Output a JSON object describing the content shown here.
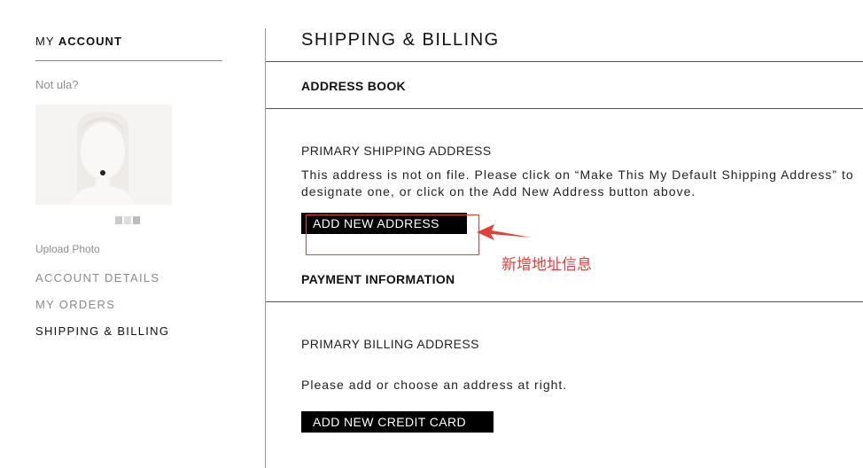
{
  "sidebar": {
    "heading_prefix": "MY",
    "heading_strong": "ACCOUNT",
    "not_user": "Not ula?",
    "upload_photo": "Upload Photo",
    "items": [
      {
        "label": "ACCOUNT DETAILS",
        "active": false
      },
      {
        "label": "MY ORDERS",
        "active": false
      },
      {
        "label": "SHIPPING & BILLING",
        "active": true
      }
    ]
  },
  "main": {
    "title": "SHIPPING & BILLING",
    "address_book": {
      "title": "ADDRESS BOOK",
      "primary_shipping_label": "PRIMARY SHIPPING ADDRESS",
      "notice": "This address is not on file. Please click on “Make This My Default Shipping Address” to designate one, or click on the Add New Address button above.",
      "add_address_button": "ADD NEW ADDRESS"
    },
    "payment": {
      "title": "PAYMENT INFORMATION",
      "primary_billing_label": "PRIMARY BILLING ADDRESS",
      "notice": "Please add or choose an address at right.",
      "add_card_button": "ADD NEW CREDIT CARD"
    }
  },
  "annotation": {
    "text": "新增地址信息",
    "color": "#e0403a"
  },
  "colors": {
    "accent": "#000000",
    "muted_text": "#8d8d8d",
    "avatar_bg": "#f6f4f3"
  }
}
